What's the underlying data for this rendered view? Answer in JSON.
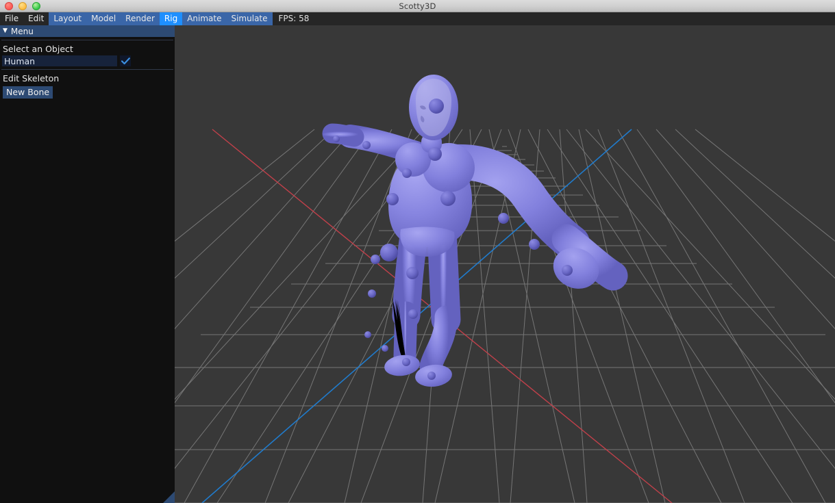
{
  "window": {
    "title": "Scotty3D",
    "traffic_lights": [
      {
        "name": "close",
        "color": "#fc5753"
      },
      {
        "name": "minimize",
        "color": "#fdbc40"
      },
      {
        "name": "zoom",
        "color": "#33c748"
      }
    ]
  },
  "menubar": {
    "items": [
      {
        "label": "File",
        "style": "plain"
      },
      {
        "label": "Edit",
        "style": "plain"
      },
      {
        "label": "Layout",
        "style": "dim"
      },
      {
        "label": "Model",
        "style": "dim"
      },
      {
        "label": "Render",
        "style": "dim"
      },
      {
        "label": "Rig",
        "style": "active"
      },
      {
        "label": "Animate",
        "style": "dim"
      },
      {
        "label": "Simulate",
        "style": "dim"
      }
    ],
    "fps_text": "FPS: 58"
  },
  "sidebar": {
    "panel_title": "Menu",
    "caret_glyph": "▼",
    "select_object_label": "Select an Object",
    "object_name_value": "Human",
    "object_name_placeholder": "",
    "confirm_icon": "check-icon",
    "edit_skeleton_label": "Edit Skeleton",
    "new_bone_label": "New Bone",
    "resize_grip_icon": "resize-grip-icon"
  },
  "viewport": {
    "name": "3d-viewport",
    "background": "#383838",
    "grid_color": "#8e8e8e",
    "axis_x_color": "#c8414b",
    "axis_z_color": "#1f7fd4",
    "model": {
      "name": "Human",
      "mesh_color": "#7b79d6",
      "joint_color": "#5f5dbd",
      "pose": "one arm raised horizontally, one arm angled down"
    }
  }
}
